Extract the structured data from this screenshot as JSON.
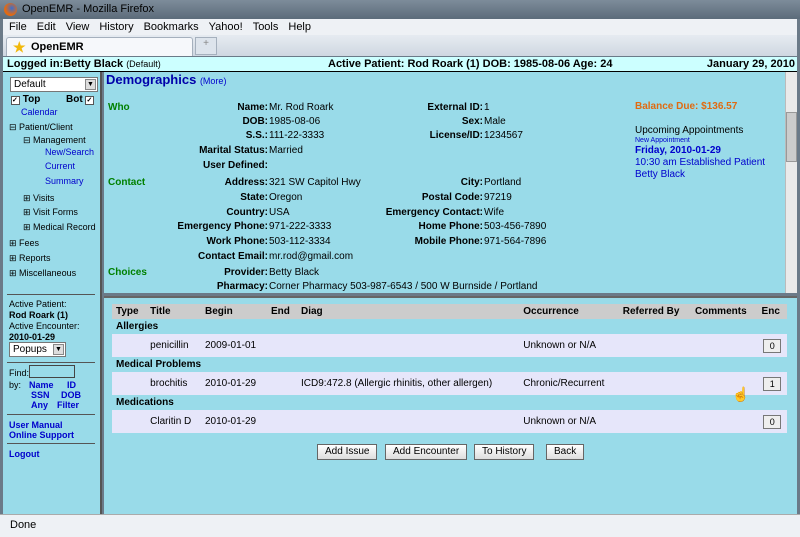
{
  "window": {
    "title": "OpenEMR - Mozilla Firefox"
  },
  "menu": [
    "File",
    "Edit",
    "View",
    "History",
    "Bookmarks",
    "Yahoo!",
    "Tools",
    "Help"
  ],
  "tab": {
    "label": "OpenEMR",
    "new_tab": "+"
  },
  "header": {
    "logged_in": "Logged in:Betty Black",
    "group": "(Default)",
    "active_patient": "Active Patient: Rod Roark (1) DOB: 1985-08-06 Age: 24",
    "date": "January 29, 2010"
  },
  "nav": {
    "layout_select": "Default",
    "top": "Top",
    "bot": "Bot",
    "calendar": "Calendar",
    "patient_client": "Patient/Client",
    "management": "Management",
    "new_search": "New/Search",
    "current": "Current",
    "summary": "Summary",
    "visits": "Visits",
    "visit_forms": "Visit Forms",
    "medical_record": "Medical Record",
    "fees": "Fees",
    "reports": "Reports",
    "misc": "Miscellaneous",
    "active_patient_label": "Active Patient:",
    "active_patient": "Rod Roark (1)",
    "active_encounter_label": "Active Encounter:",
    "active_encounter": "2010-01-29",
    "popups": "Popups",
    "find": "Find:",
    "by": "by:",
    "name": "Name",
    "id": "ID",
    "ssn": "SSN",
    "dob": "DOB",
    "any": "Any",
    "filter": "Filter",
    "user_manual": "User Manual",
    "online_support": "Online Support",
    "logout": "Logout"
  },
  "demographics": {
    "title": "Demographics",
    "more": "(More)",
    "sections": {
      "who": "Who",
      "contact": "Contact",
      "choices": "Choices"
    },
    "fields": {
      "name": [
        "Name:",
        "Mr. Rod  Roark"
      ],
      "dob": [
        "DOB:",
        "1985-08-06"
      ],
      "ss": [
        "S.S.:",
        "111-22-3333"
      ],
      "marital": [
        "Marital Status:",
        "Married"
      ],
      "user_defined": [
        "User Defined:",
        ""
      ],
      "external_id": [
        "External ID:",
        "1"
      ],
      "sex": [
        "Sex:",
        "Male"
      ],
      "license": [
        "License/ID:",
        "1234567"
      ],
      "address": [
        "Address:",
        "321 SW Capitol Hwy"
      ],
      "state": [
        "State:",
        "Oregon"
      ],
      "country": [
        "Country:",
        "USA"
      ],
      "emergency_phone": [
        "Emergency Phone:",
        "971-222-3333"
      ],
      "work_phone": [
        "Work Phone:",
        "503-112-3334"
      ],
      "email": [
        "Contact Email:",
        "mr.rod@gmail.com"
      ],
      "city": [
        "City:",
        "Portland"
      ],
      "postal": [
        "Postal Code:",
        "97219"
      ],
      "emergency_contact": [
        "Emergency Contact:",
        "Wife"
      ],
      "home_phone": [
        "Home Phone:",
        "503-456-7890"
      ],
      "mobile_phone": [
        "Mobile Phone:",
        "971-564-7896"
      ],
      "provider": [
        "Provider:",
        "Betty Black"
      ],
      "pharmacy": [
        "Pharmacy:",
        "Corner Pharmacy 503-987-6543 / 500 W Burnside / Portland"
      ]
    },
    "balance": "Balance Due: $136.57",
    "appointments": {
      "label": "Upcoming Appointments",
      "new": "New Appointment",
      "date": "Friday, 2010-01-29",
      "time": "10:30 am Established Patient",
      "provider": "Betty Black"
    }
  },
  "issues": {
    "columns": [
      "Type",
      "Title",
      "Begin",
      "End",
      "Diag",
      "Occurrence",
      "Referred By",
      "Comments",
      "Enc"
    ],
    "groups": [
      {
        "name": "Allergies",
        "rows": [
          {
            "title": "penicillin",
            "begin": "2009-01-01",
            "end": "",
            "diag": "",
            "occurrence": "Unknown or N/A",
            "referred": "",
            "comments": "",
            "enc": "0"
          }
        ]
      },
      {
        "name": "Medical Problems",
        "rows": [
          {
            "title": "brochitis",
            "begin": "2010-01-29",
            "end": "",
            "diag": "ICD9:472.8 (Allergic rhinitis, other allergen)",
            "occurrence": "Chronic/Recurrent",
            "referred": "",
            "comments": "",
            "enc": "1"
          }
        ]
      },
      {
        "name": "Medications",
        "rows": [
          {
            "title": "Claritin D",
            "begin": "2010-01-29",
            "end": "",
            "diag": "",
            "occurrence": "Unknown or N/A",
            "referred": "",
            "comments": "",
            "enc": "0"
          }
        ]
      }
    ],
    "buttons": {
      "add_issue": "Add Issue",
      "add_encounter": "Add Encounter",
      "to_history": "To History",
      "back": "Back"
    }
  },
  "status": "Done"
}
